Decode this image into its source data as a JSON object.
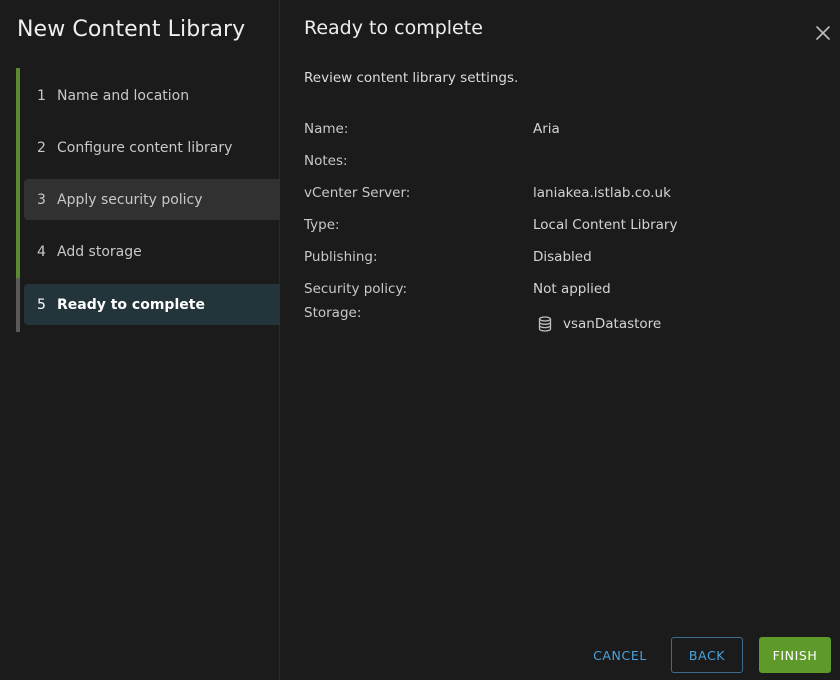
{
  "wizard": {
    "title": "New Content Library",
    "steps": [
      {
        "num": "1",
        "label": "Name and location",
        "state": "completed"
      },
      {
        "num": "2",
        "label": "Configure content library",
        "state": "completed"
      },
      {
        "num": "3",
        "label": "Apply security policy",
        "state": "visited"
      },
      {
        "num": "4",
        "label": "Add storage",
        "state": "completed"
      },
      {
        "num": "5",
        "label": "Ready to complete",
        "state": "current"
      }
    ]
  },
  "page": {
    "title": "Ready to complete",
    "intro": "Review content library settings.",
    "summary": [
      {
        "key": "Name:",
        "value": "Aria"
      },
      {
        "key": "Notes:",
        "value": ""
      },
      {
        "key": "vCenter Server:",
        "value": "laniakea.istlab.co.uk"
      },
      {
        "key": "Type:",
        "value": "Local Content Library"
      },
      {
        "key": "Publishing:",
        "value": "Disabled"
      },
      {
        "key": "Security policy:",
        "value": "Not applied"
      },
      {
        "key": "Storage:",
        "value": "vsanDatastore",
        "icon": "database-icon"
      }
    ]
  },
  "footer": {
    "cancel_label": "CANCEL",
    "back_label": "BACK",
    "finish_label": "FINISH"
  },
  "icons": {
    "close": "close-icon",
    "storage": "database-icon"
  },
  "colors": {
    "background": "#1b1b1b",
    "progress_completed": "#5b8a2e",
    "current_step_bg": "#23343b",
    "link_blue": "#4aa3df",
    "primary_green": "#5d9a2a"
  }
}
